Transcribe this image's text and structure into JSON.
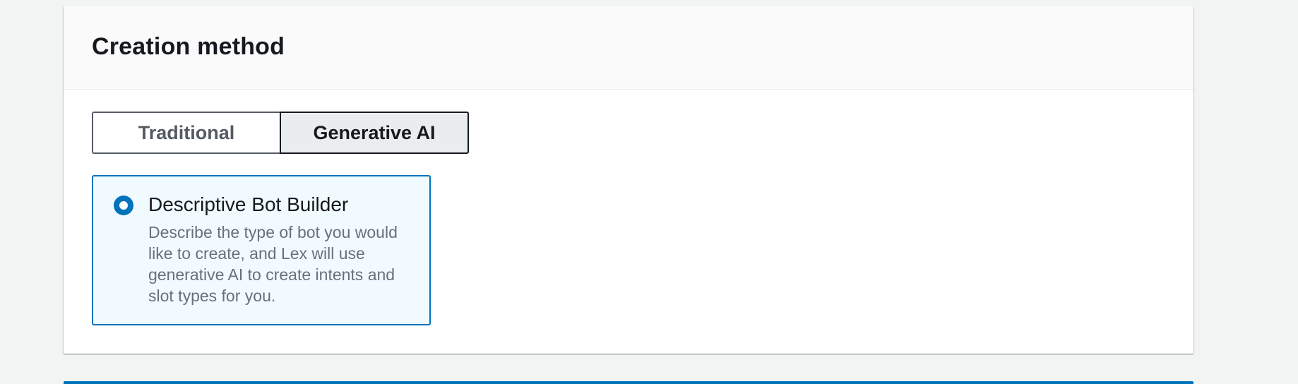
{
  "section": {
    "title": "Creation method"
  },
  "segmented_control": {
    "options": [
      {
        "label": "Traditional",
        "selected": false
      },
      {
        "label": "Generative AI",
        "selected": true
      }
    ]
  },
  "option_tile": {
    "title": "Descriptive Bot Builder",
    "description": "Describe the type of bot you would like to create, and Lex will use generative AI to create intents and slot types for you.",
    "selected": true
  },
  "colors": {
    "accent": "#0073bb",
    "tile_background": "#f1faff",
    "page_background": "#f2f3f3",
    "text_primary": "#16191f",
    "text_secondary": "#687078"
  }
}
